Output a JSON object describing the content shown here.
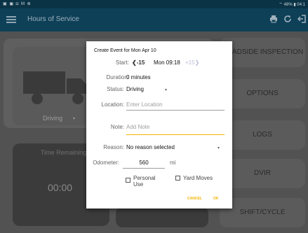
{
  "statusbar": {
    "left_icons": "▣ ▣ ◘ M ⊕",
    "right": "⌔ 48% ▮ 04:1"
  },
  "appbar": {
    "title": "Hours of Service"
  },
  "left_panel": {
    "status": "Driving",
    "time_label": "Time Remaining",
    "time_value": "00:00"
  },
  "side_buttons": [
    "ROADSIDE INSPECTION",
    "OPTIONS",
    "LOGS",
    "DVIR",
    "SHIFT/CYCLE"
  ],
  "dialog": {
    "title": "Create Event for Mon Apr 10",
    "start_label": "Start:",
    "start_prev": "❮-15",
    "start_value": "Mon 09:18",
    "start_next": "+15❯",
    "duration_label": "Duration:",
    "duration_value": "0 minutes",
    "status_label": "Status:",
    "status_value": "Driving",
    "location_label": "Location:",
    "location_placeholder": "Enter Location",
    "note_label": "Note:",
    "note_placeholder": "Add Note",
    "reason_label": "Reason:",
    "reason_value": "No reason selected",
    "odometer_label": "Odometer:",
    "odometer_value": "560",
    "odometer_unit": "mi",
    "personal_use_label_1": "Personal",
    "personal_use_label_2": "Use",
    "yard_moves_label": "Yard Moves",
    "cancel_label": "CANCEL",
    "ok_label": "OK"
  },
  "colors": {
    "appbar": "#0e4058",
    "accent": "#f0b400"
  }
}
